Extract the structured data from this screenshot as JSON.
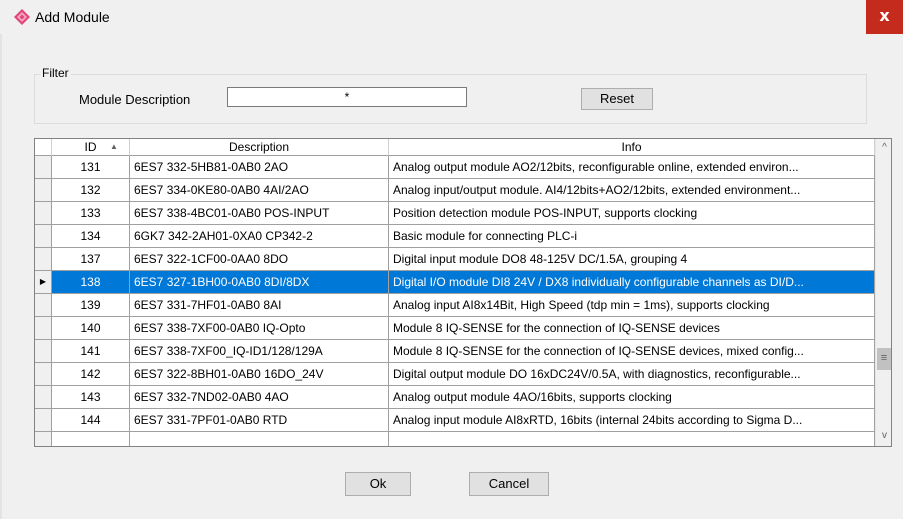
{
  "window": {
    "title": "Add Module",
    "close_glyph": "x",
    "icon": "module-diamond-icon",
    "icon_color": "#e0457b"
  },
  "filter": {
    "group_label": "Filter",
    "field_label": "Module Description",
    "value": "*",
    "reset_label": "Reset"
  },
  "grid": {
    "columns": [
      "ID",
      "Description",
      "Info"
    ],
    "sort_indicator": "▲",
    "selected_marker": "▶",
    "selection_color": "#0078d7",
    "rows": [
      {
        "id": "131",
        "description": "6ES7 332-5HB81-0AB0      2AO",
        "info": "Analog output module AO2/12bits, reconfigurable online, extended environ...",
        "selected": false
      },
      {
        "id": "132",
        "description": "6ES7 334-0KE80-0AB0   4AI/2AO",
        "info": "Analog input/output module. AI4/12bits+AO2/12bits, extended environment...",
        "selected": false
      },
      {
        "id": "133",
        "description": "6ES7 338-4BC01-0AB0  POS-INPUT",
        "info": "Position detection module POS-INPUT, supports clocking",
        "selected": false
      },
      {
        "id": "134",
        "description": "6GK7 342-2AH01-0XA0    CP342-2",
        "info": "Basic module for connecting PLC-i",
        "selected": false
      },
      {
        "id": "137",
        "description": "6ES7 322-1CF00-0AA0        8DO",
        "info": "Digital input module DO8 48-125V DC/1.5A, grouping 4",
        "selected": false
      },
      {
        "id": "138",
        "description": "6ES7 327-1BH00-0AB0     8DI/8DX",
        "info": "Digital I/O module DI8 24V / DX8 individually configurable channels as DI/D...",
        "selected": true
      },
      {
        "id": "139",
        "description": "6ES7 331-7HF01-0AB0         8AI",
        "info": "Analog input AI8x14Bit, High Speed (tdp min = 1ms), supports clocking",
        "selected": false
      },
      {
        "id": "140",
        "description": "6ES7 338-7XF00-0AB0  IQ-Opto",
        "info": "Module 8 IQ-SENSE for the connection of IQ-SENSE devices",
        "selected": false
      },
      {
        "id": "141",
        "description": "6ES7 338-7XF00_IQ-ID1/128/129A",
        "info": "Module 8 IQ-SENSE for the connection of IQ-SENSE devices, mixed config...",
        "selected": false
      },
      {
        "id": "142",
        "description": "6ES7 322-8BH01-0AB0   16DO_24V",
        "info": "Digital output module  DO 16xDC24V/0.5A, with diagnostics, reconfigurable...",
        "selected": false
      },
      {
        "id": "143",
        "description": "6ES7 332-7ND02-0AB0        4AO",
        "info": "Analog output module 4AO/16bits, supports clocking",
        "selected": false
      },
      {
        "id": "144",
        "description": "6ES7 331-7PF01-0AB0        RTD",
        "info": "Analog input module AI8xRTD, 16bits (internal 24bits according to Sigma D...",
        "selected": false
      }
    ]
  },
  "scrollbar": {
    "up_glyph": "^",
    "down_glyph": "v",
    "thumb_glyph": "≡"
  },
  "buttons": {
    "ok_label": "Ok",
    "cancel_label": "Cancel"
  }
}
